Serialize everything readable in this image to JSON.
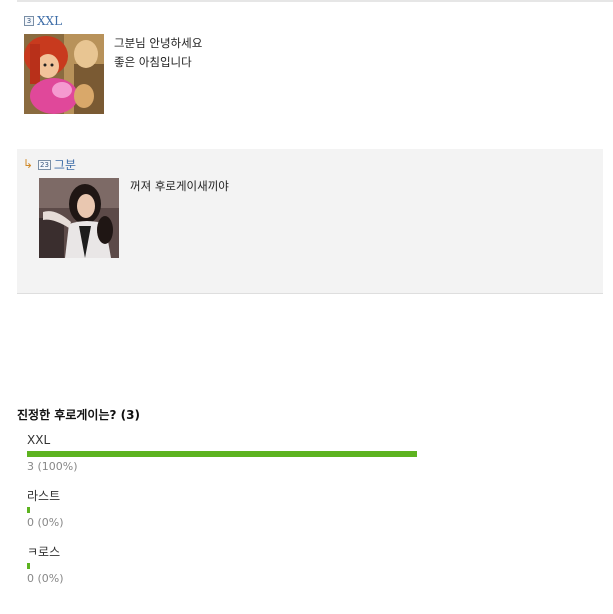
{
  "comments": [
    {
      "level": "3",
      "author": "XXL",
      "lines": [
        "그분님 안녕하세요",
        "좋은 아침입니다"
      ],
      "avatar": "anime-character-avatar"
    }
  ],
  "reply": {
    "reply_icon": "reply-arrow-icon",
    "level": "23",
    "author": "그분",
    "text": "꺼져 후로게이새끼야",
    "avatar": "woman-photo-avatar"
  },
  "poll": {
    "title": "진정한 후로게이는? (3)",
    "options": [
      {
        "label": "XXL",
        "count": "3 (100%)",
        "fraction": 1.0
      },
      {
        "label": "라스트",
        "count": "0 (0%)",
        "fraction": 0.0
      },
      {
        "label": "ㅋ로스",
        "count": "0 (0%)",
        "fraction": 0.0
      }
    ],
    "bar_color": "#5db320"
  }
}
